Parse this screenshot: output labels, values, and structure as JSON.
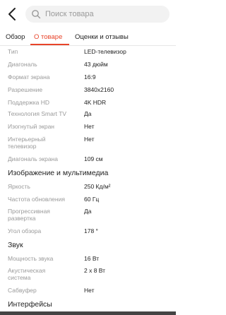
{
  "search": {
    "placeholder": "Поиск товара"
  },
  "tabs": [
    {
      "label": "Обзор"
    },
    {
      "label": "О товаре"
    },
    {
      "label": "Оценки и отзывы"
    }
  ],
  "specs_main": [
    {
      "label": "Тип",
      "value": "LED-телевизор"
    },
    {
      "label": "Диагональ",
      "value": "43 дюйм"
    },
    {
      "label": "Формат экрана",
      "value": "16:9"
    },
    {
      "label": "Разрешение",
      "value": "3840x2160"
    },
    {
      "label": "Поддержка HD",
      "value": "4K HDR"
    },
    {
      "label": "Технология Smart TV",
      "value": "Да"
    },
    {
      "label": "Изогнутый экран",
      "value": "Нет"
    },
    {
      "label": "Интерьерный телевизор",
      "value": "Нет"
    },
    {
      "label": "Диагональ экрана",
      "value": "109 см"
    }
  ],
  "section_image": {
    "title": "Изображение и мультимедиа"
  },
  "specs_image": [
    {
      "label": "Яркость",
      "value": "250 Кд/м²"
    },
    {
      "label": "Частота обновления",
      "value": "60 Гц"
    },
    {
      "label": "Прогрессивная развертка",
      "value": "Да"
    },
    {
      "label": "Угол обзора",
      "value": "178 °"
    }
  ],
  "section_sound": {
    "title": "Звук"
  },
  "specs_sound": [
    {
      "label": "Мощность звука",
      "value": "16 Вт"
    },
    {
      "label": "Акустическая система",
      "value": "2 x 8 Вт"
    },
    {
      "label": "Сабвуфер",
      "value": "Нет"
    }
  ],
  "section_interfaces": {
    "title": "Интерфейсы"
  }
}
